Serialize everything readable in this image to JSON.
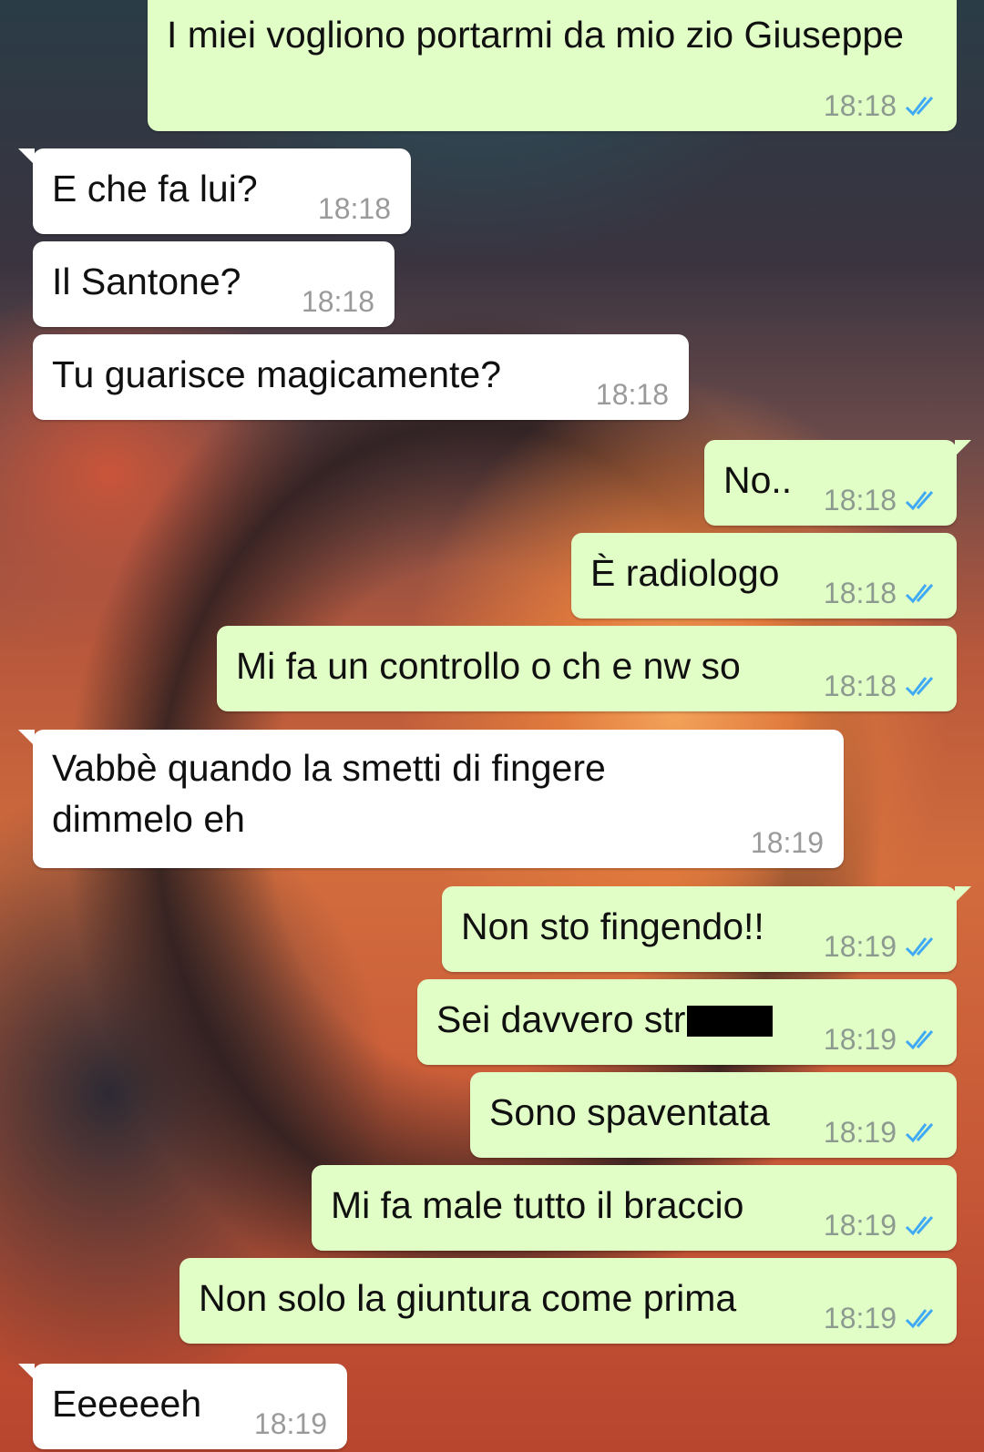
{
  "messages": [
    {
      "direction": "out",
      "text": "I miei vogliono portarmi da mio zio Giuseppe",
      "time": "18:18",
      "ticks": "read-double-check"
    },
    {
      "direction": "in",
      "text": "E che fa lui?",
      "time": "18:18"
    },
    {
      "direction": "in",
      "text": "Il Santone?",
      "time": "18:18"
    },
    {
      "direction": "in",
      "text": "Tu guarisce magicamente?",
      "time": "18:18"
    },
    {
      "direction": "out",
      "text": "No..",
      "time": "18:18",
      "ticks": "read-double-check"
    },
    {
      "direction": "out",
      "text": "È radiologo",
      "time": "18:18",
      "ticks": "read-double-check"
    },
    {
      "direction": "out",
      "text": "Mi fa un controllo o ch e nw so",
      "time": "18:18",
      "ticks": "read-double-check"
    },
    {
      "direction": "in",
      "text": "Vabbè quando la smetti di fingere dimmelo eh",
      "time": "18:19"
    },
    {
      "direction": "out",
      "text": "Non sto fingendo!!",
      "time": "18:19",
      "ticks": "read-double-check"
    },
    {
      "direction": "out",
      "text": "Sei davvero str",
      "redacted": true,
      "time": "18:19",
      "ticks": "read-double-check"
    },
    {
      "direction": "out",
      "text": "Sono spaventata",
      "time": "18:19",
      "ticks": "read-double-check"
    },
    {
      "direction": "out",
      "text": "Mi fa male tutto il braccio",
      "time": "18:19",
      "ticks": "read-double-check"
    },
    {
      "direction": "out",
      "text": "Non solo la giuntura come prima",
      "time": "18:19",
      "ticks": "read-double-check"
    },
    {
      "direction": "in",
      "text": "Eeeeeeh",
      "time": "18:19"
    }
  ],
  "colors": {
    "incoming_bubble": "#ffffff",
    "outgoing_bubble": "#e1fec6",
    "read_tick": "#3fa9f5",
    "timestamp": "#8d9a90"
  }
}
